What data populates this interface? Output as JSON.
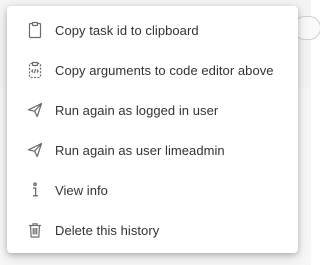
{
  "menu": {
    "items": [
      {
        "label": "Copy task id to clipboard",
        "icon": "clipboard-icon"
      },
      {
        "label": "Copy arguments to code editor above",
        "icon": "clipboard-code-icon"
      },
      {
        "label": "Run again as logged in user",
        "icon": "send-icon"
      },
      {
        "label": "Run again as user limeadmin",
        "icon": "send-icon"
      },
      {
        "label": "View info",
        "icon": "info-icon"
      },
      {
        "label": "Delete this history",
        "icon": "trash-icon"
      }
    ]
  },
  "colors": {
    "text": "#333333",
    "icon": "#6b6b6b",
    "menu_background": "#ffffff"
  }
}
